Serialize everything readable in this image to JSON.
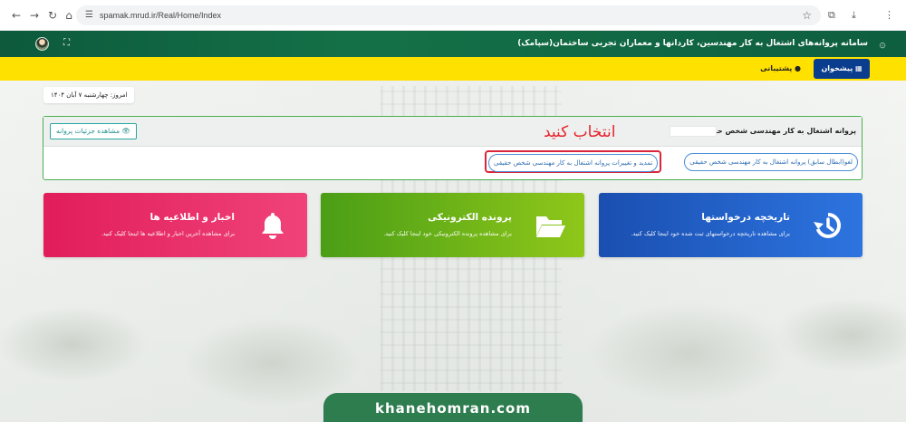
{
  "browser": {
    "url": "spamak.mrud.ir/Real/Home/Index"
  },
  "header": {
    "site_title": "سامانه پروانه‌های اشتغال به کار مهندسین، کاردانها و معماران تجربی ساختمان(سپامک)"
  },
  "nav": {
    "desk_label": "پیشخوان",
    "support_label": "پشتیبانی"
  },
  "date_badge": "امروز: چهارشنبه ۷ آبان ۱۴۰۴",
  "license_panel": {
    "title": "پروانه اشتغال به کار مهندسی شخص حقیقی :",
    "select_hint": "انتخاب کنید",
    "details_button": "مشاهده جزئیات پروانه",
    "operations": [
      "لغو(ابطال سابق) پروانه اشتغال به کار مهندسی شخص حقیقی",
      "تمدید و تغییرات پروانه اشتغال به کار مهندسی شخص حقیقی"
    ]
  },
  "cards": {
    "history": {
      "title": "تاریخچه درخواستها",
      "desc": "برای مشاهده تاریخچه درخواستهای ثبت شده خود اینجا کلیک کنید.",
      "color": "#1a4fb0"
    },
    "file": {
      "title": "پرونده الکترونیکی",
      "desc": "برای مشاهده پرونده الکترونیکی خود اینجا کلیک کنید.",
      "color": "#5aaa17"
    },
    "news": {
      "title": "اخبار و اطلاعیه ها",
      "desc": "برای مشاهده آخرین اخبار و اطلاعیه ها اینجا کلیک کنید.",
      "color": "#e11d5a"
    }
  },
  "watermark": "khanehomran.com",
  "colors": {
    "header_green": "#0d5a3d",
    "nav_yellow": "#ffe100",
    "desk_blue": "#0b3d8f",
    "highlight_red": "#d9263a"
  }
}
